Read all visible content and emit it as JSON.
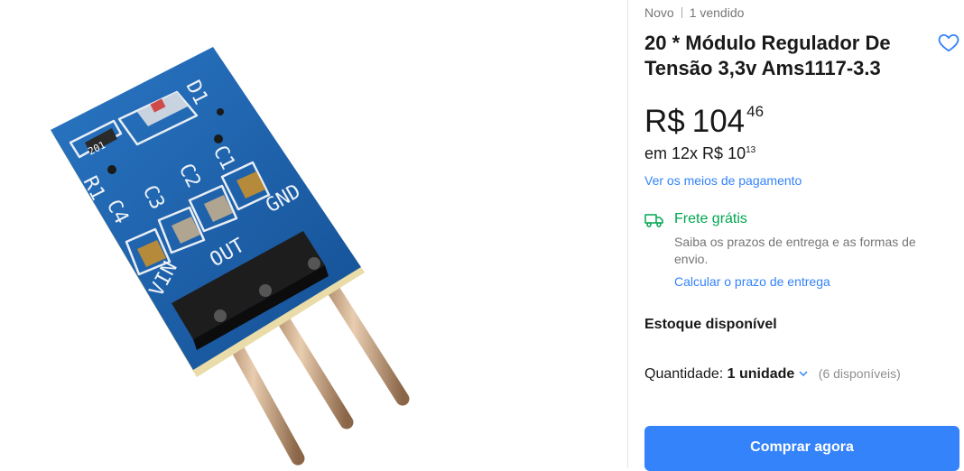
{
  "product": {
    "condition": "Novo",
    "sold": "1 vendido",
    "title": "20 * Módulo Regulador De Tensão 3,3v Ams1117-3.3",
    "price": {
      "currency": "R$",
      "integer": "104",
      "cents": "46"
    },
    "installments": {
      "prefix": "em 12x",
      "currency": "R$",
      "integer": "10",
      "cents": "13"
    },
    "payment_link": "Ver os meios de pagamento",
    "favorite_icon": "heart-outline-icon"
  },
  "shipping": {
    "icon": "truck-icon",
    "title": "Frete grátis",
    "description": "Saiba os prazos de entrega e as formas de envio.",
    "link": "Calcular o prazo de entrega"
  },
  "stock": {
    "label": "Estoque disponível",
    "quantity_label": "Quantidade:",
    "quantity_value": "1 unidade",
    "available": "(6 disponíveis)"
  },
  "actions": {
    "buy": "Comprar agora"
  },
  "image": {
    "board_labels": [
      "D1",
      "201",
      "R1",
      "C1",
      "C2",
      "C3",
      "C4",
      "GND",
      "OUT",
      "VIN"
    ]
  },
  "colors": {
    "accent": "#3483fa",
    "free_shipping": "#00a650",
    "pcb": "#1a5fa8"
  }
}
